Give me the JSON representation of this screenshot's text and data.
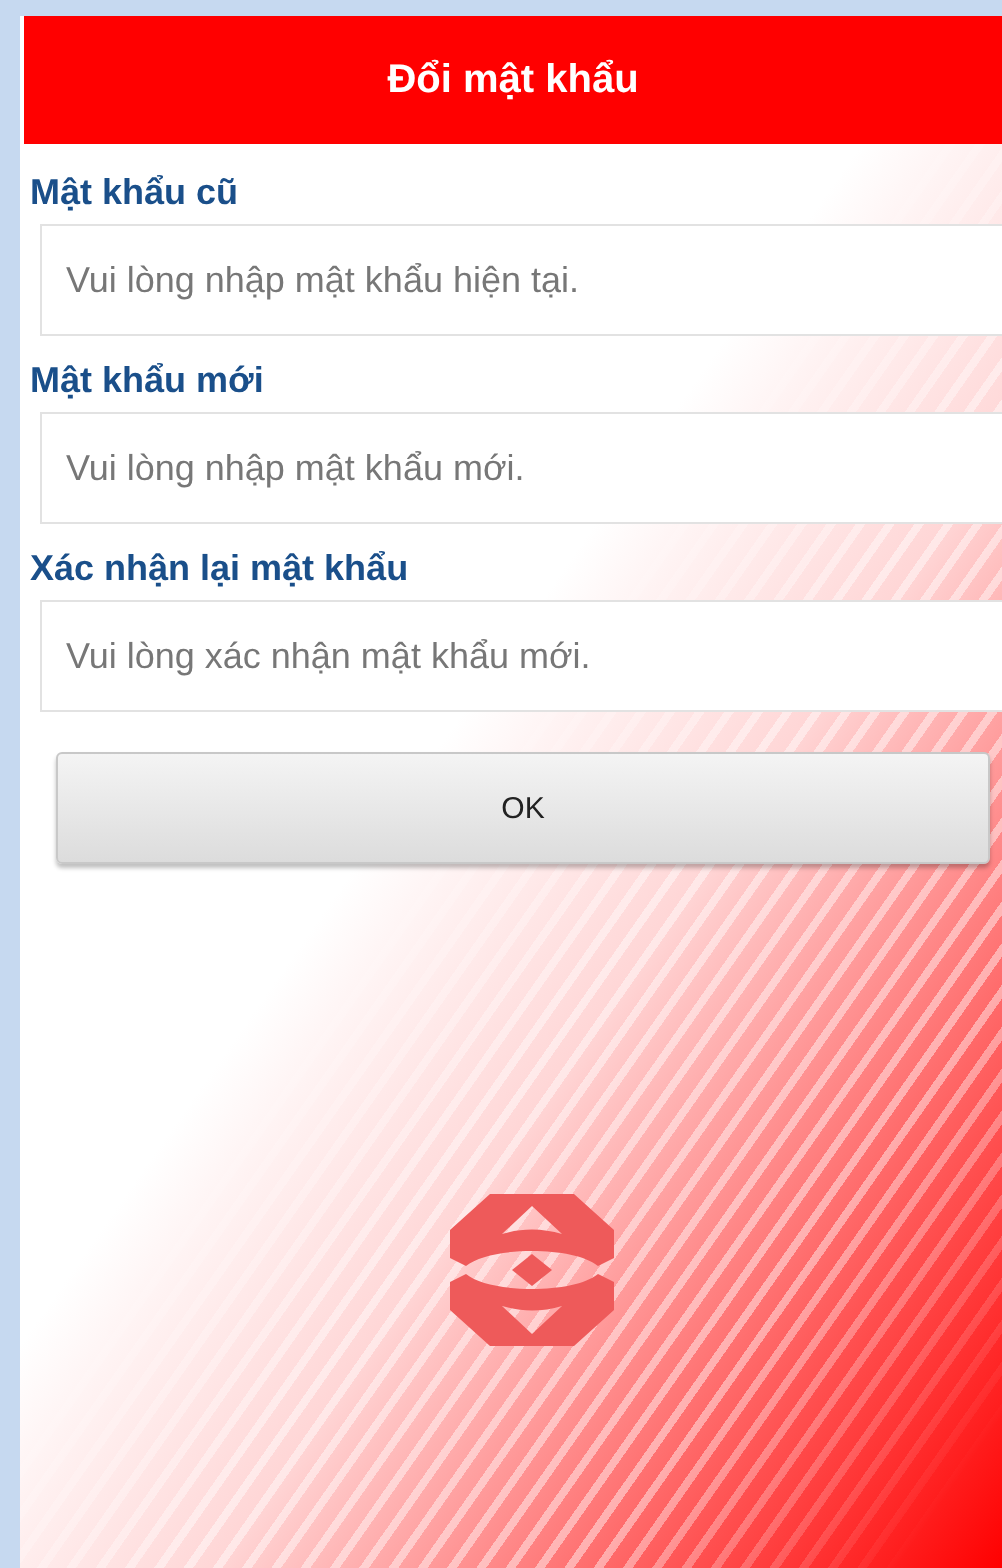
{
  "header": {
    "title": "Đổi mật khẩu"
  },
  "fields": [
    {
      "label": "Mật khẩu cũ",
      "placeholder": "Vui lòng nhập mật khẩu hiện tại."
    },
    {
      "label": "Mật khẩu mới",
      "placeholder": "Vui lòng nhập mật khẩu mới."
    },
    {
      "label": "Xác nhận lại mật khẩu",
      "placeholder": "Vui lòng xác nhận mật khẩu mới."
    }
  ],
  "button": {
    "label": "OK"
  }
}
